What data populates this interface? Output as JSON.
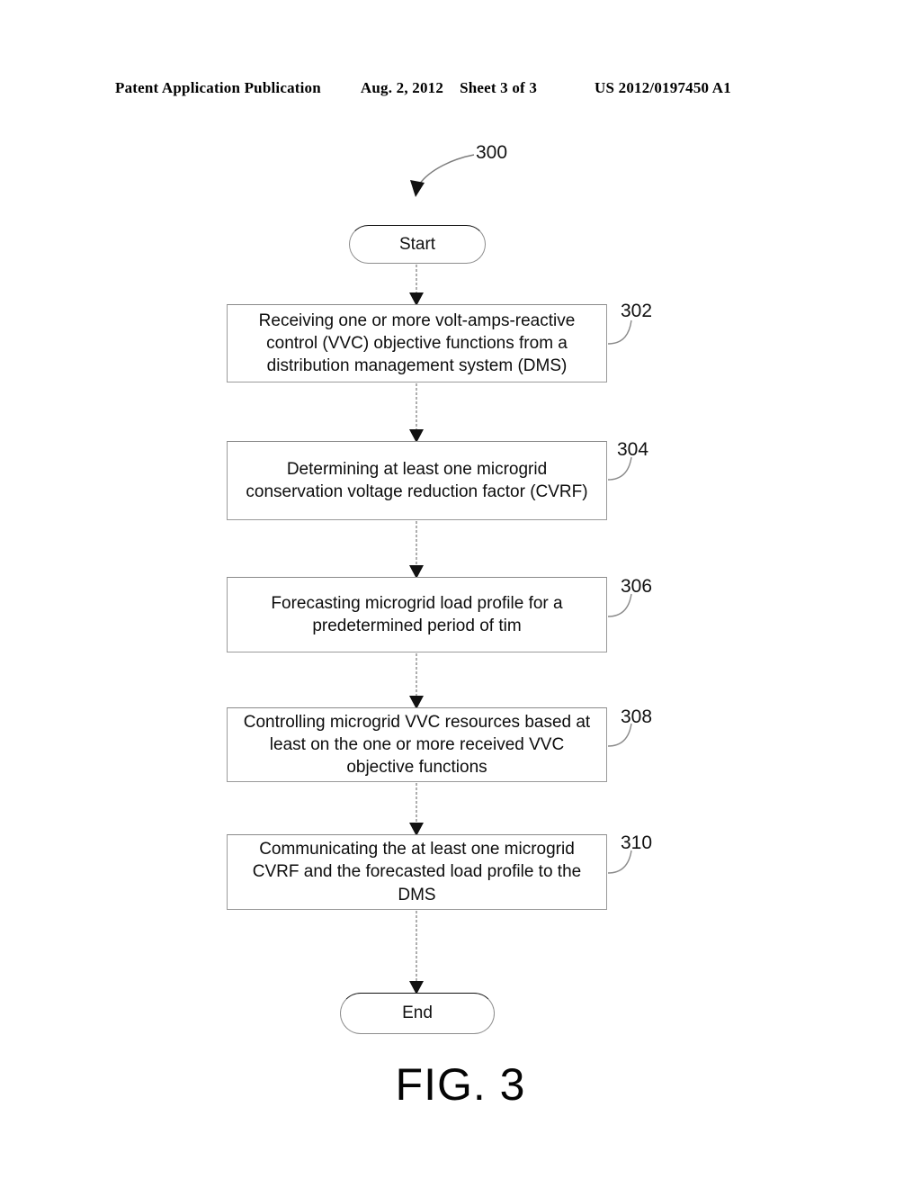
{
  "header": {
    "publication": "Patent Application Publication",
    "date": "Aug. 2, 2012",
    "sheet": "Sheet 3 of 3",
    "patent_number": "US 2012/0197450 A1"
  },
  "figure": {
    "caption": "FIG. 3",
    "diagram_ref": "300",
    "nodes": [
      {
        "id": "start",
        "type": "terminator",
        "label": "Start",
        "ref": "300"
      },
      {
        "id": "step302",
        "type": "process",
        "ref": "302",
        "label": "Receiving one or more volt-amps-reactive control (VVC) objective functions from a distribution management system (DMS)"
      },
      {
        "id": "step304",
        "type": "process",
        "ref": "304",
        "label": "Determining at least one microgrid conservation voltage reduction factor (CVRF)"
      },
      {
        "id": "step306",
        "type": "process",
        "ref": "306",
        "label": "Forecasting microgrid load profile for a predetermined period of tim"
      },
      {
        "id": "step308",
        "type": "process",
        "ref": "308",
        "label": "Controlling microgrid VVC resources based at least on the one or more received VVC objective functions"
      },
      {
        "id": "step310",
        "type": "process",
        "ref": "310",
        "label": "Communicating the at least one microgrid CVRF and the forecasted load profile to the DMS"
      },
      {
        "id": "end",
        "type": "terminator",
        "label": "End"
      }
    ]
  },
  "colors": {
    "ink": "#000000",
    "box_stroke": "#9a9a9a",
    "connector": "#9b9b9b",
    "arrowhead": "#111111",
    "background": "#ffffff"
  }
}
